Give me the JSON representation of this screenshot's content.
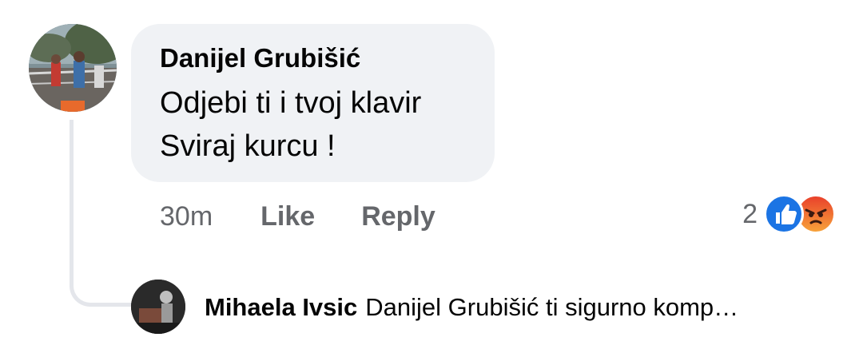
{
  "comment": {
    "author": "Danijel Grubišić",
    "lines": [
      "Odjebi ti i tvoj klavir",
      "Sviraj kurcu !"
    ],
    "time": "30m",
    "like_label": "Like",
    "reply_label": "Reply",
    "reaction_count": "2",
    "reactions": [
      "like-icon",
      "angry-icon"
    ],
    "avatar": "user-avatar-photo"
  },
  "reply_preview": {
    "author": "Mihaela Ivsic",
    "text": "Danijel Grubišić ti sigurno komp…",
    "avatar": "user-avatar-photo"
  },
  "colors": {
    "bubble_bg": "#f0f2f5",
    "secondary_text": "#65676b",
    "like_blue": "#1b74e4",
    "thread_line": "#e4e6eb"
  }
}
